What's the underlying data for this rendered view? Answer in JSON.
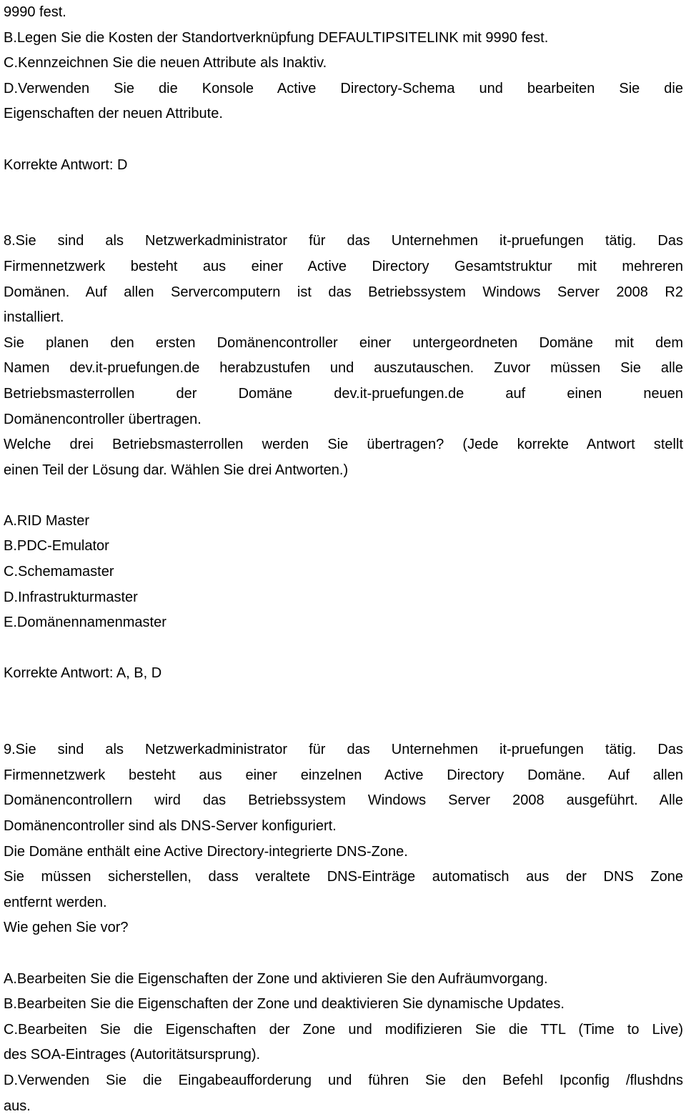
{
  "q7": {
    "option_a_tail": "9990 fest.",
    "option_b": "B.Legen Sie die Kosten der Standortverknüpfung DEFAULTIPSITELINK mit 9990 fest.",
    "option_c": "C.Kennzeichnen Sie die neuen Attribute als Inaktiv.",
    "option_d_line1": "D.Verwenden Sie die Konsole Active Directory-Schema und bearbeiten Sie die",
    "option_d_line2": "Eigenschaften der neuen Attribute.",
    "answer": "Korrekte Antwort: D"
  },
  "q8": {
    "question_lines": [
      "8.Sie sind als Netzwerkadministrator für das Unternehmen it-pruefungen tätig. Das",
      "Firmennetzwerk besteht aus einer Active Directory Gesamtstruktur mit mehreren",
      "Domänen. Auf allen Servercomputern ist das Betriebssystem Windows Server 2008 R2",
      "installiert.",
      "Sie planen den ersten Domänencontroller einer untergeordneten Domäne mit dem",
      "Namen dev.it-pruefungen.de herabzustufen und auszutauschen. Zuvor müssen Sie alle",
      "Betriebsmasterrollen der Domäne dev.it-pruefungen.de auf einen neuen",
      "Domänencontroller übertragen.",
      "Welche drei Betriebsmasterrollen werden Sie übertragen? (Jede korrekte Antwort stellt",
      "einen Teil der Lösung dar. Wählen Sie drei Antworten.)"
    ],
    "options": [
      "A.RID Master",
      "B.PDC-Emulator",
      "C.Schemamaster",
      "D.Infrastrukturmaster",
      "E.Domänennamenmaster"
    ],
    "answer": "Korrekte Antwort: A, B, D"
  },
  "q9": {
    "question_lines": [
      "9.Sie sind als Netzwerkadministrator für das Unternehmen it-pruefungen tätig. Das",
      "Firmennetzwerk besteht aus einer einzelnen Active Directory Domäne. Auf allen",
      "Domänencontrollern wird das Betriebssystem Windows Server 2008 ausgeführt. Alle",
      "Domänencontroller sind als DNS-Server konfiguriert.",
      "Die Domäne enthält eine Active Directory-integrierte DNS-Zone.",
      "Sie müssen sicherstellen, dass veraltete DNS-Einträge automatisch aus der DNS Zone",
      "entfernt werden.",
      "Wie gehen Sie vor?"
    ],
    "options": [
      "A.Bearbeiten Sie die Eigenschaften der Zone und aktivieren Sie den Aufräumvorgang.",
      "B.Bearbeiten Sie die Eigenschaften der Zone und deaktivieren Sie dynamische Updates.",
      "C.Bearbeiten Sie die Eigenschaften der Zone und modifizieren Sie die TTL (Time to Live)",
      "des SOA-Eintrages (Autoritätsursprung).",
      "D.Verwenden Sie die Eingabeaufforderung und führen Sie den Befehl Ipconfig /flushdns",
      "aus."
    ]
  }
}
